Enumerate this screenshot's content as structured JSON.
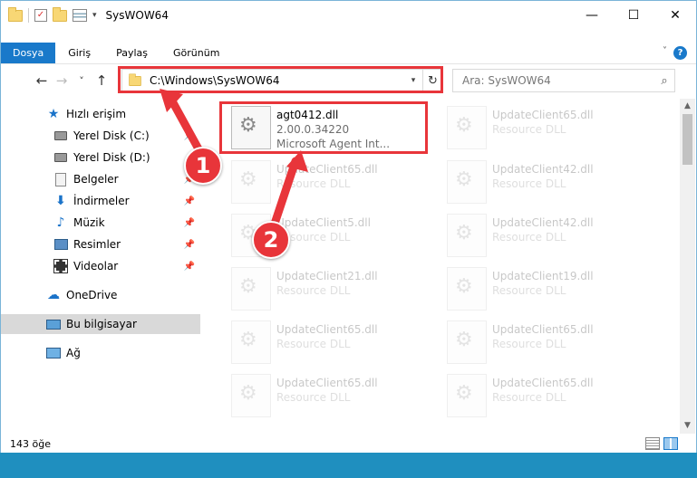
{
  "window": {
    "title": "SysWOW64"
  },
  "quick_access_toolbar": {
    "caret": "▾"
  },
  "window_controls": {
    "minimize": "—",
    "maximize": "☐",
    "close": "✕"
  },
  "ribbon": {
    "tabs": [
      {
        "label": "Dosya"
      },
      {
        "label": "Giriş"
      },
      {
        "label": "Paylaş"
      },
      {
        "label": "Görünüm"
      }
    ],
    "help": "?"
  },
  "navigation": {
    "back": "←",
    "forward": "→",
    "recent": "˅",
    "up": "↑",
    "address": "C:\\Windows\\SysWOW64",
    "refresh": "↻",
    "search_placeholder": "Ara: SysWOW64"
  },
  "sidebar": {
    "items": [
      {
        "label": "Hızlı erişim",
        "icon": "star-icon"
      },
      {
        "label": "Yerel Disk (C:)",
        "icon": "disk-icon"
      },
      {
        "label": "Yerel Disk (D:)",
        "icon": "disk-icon"
      },
      {
        "label": "Belgeler",
        "icon": "document-icon"
      },
      {
        "label": "İndirmeler",
        "icon": "download-icon"
      },
      {
        "label": "Müzik",
        "icon": "music-icon"
      },
      {
        "label": "Resimler",
        "icon": "pictures-icon"
      },
      {
        "label": "Videolar",
        "icon": "video-icon"
      },
      {
        "label": "OneDrive",
        "icon": "cloud-icon"
      },
      {
        "label": "Bu bilgisayar",
        "icon": "computer-icon"
      },
      {
        "label": "Ağ",
        "icon": "network-icon"
      }
    ]
  },
  "files": {
    "highlighted": {
      "name": "agt0412.dll",
      "version": "2.00.0.34220",
      "description": "Microsoft Agent Int..."
    },
    "tiles": [
      {
        "name": "UpdateClient65.dll",
        "type": "Resource DLL"
      },
      {
        "name": "UpdateClient65.dll",
        "type": "Resource DLL"
      },
      {
        "name": "UpdateClient42.dll",
        "type": "Resource DLL"
      },
      {
        "name": "UpdateClient5.dll",
        "type": "Resource DLL"
      },
      {
        "name": "UpdateClient42.dll",
        "type": "Resource DLL"
      },
      {
        "name": "UpdateClient21.dll",
        "type": "Resource DLL"
      },
      {
        "name": "UpdateClient19.dll",
        "type": "Resource DLL"
      },
      {
        "name": "UpdateClient65.dll",
        "type": "Resource DLL"
      },
      {
        "name": "UpdateClient65.dll",
        "type": "Resource DLL"
      },
      {
        "name": "UpdateClient65.dll",
        "type": "Resource DLL"
      },
      {
        "name": "UpdateClient65.dll",
        "type": "Resource DLL"
      }
    ]
  },
  "status": {
    "item_count": "143 öğe"
  },
  "annotations": {
    "step1": "1",
    "step2": "2",
    "color": "#e8353a"
  },
  "scrollbar": {
    "up": "▲",
    "down": "▼"
  }
}
